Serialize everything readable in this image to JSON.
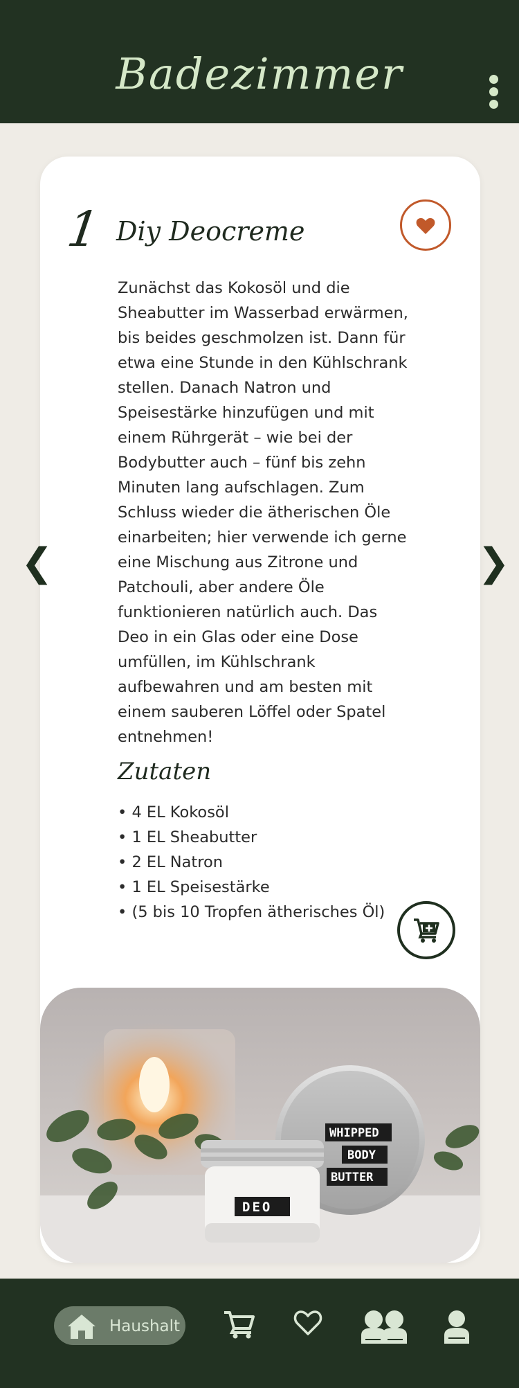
{
  "header": {
    "title": "Badezimmer",
    "menu_icon": "kebab-menu-icon"
  },
  "recipe": {
    "number": "1",
    "title": "Diy Deocreme",
    "favorite_icon": "heart-icon",
    "description": "Zunächst das Kokosöl und die Sheabutter im Wasserbad erwärmen, bis beides geschmolzen ist. Dann für etwa eine Stunde in den Kühlschrank stellen. Danach Natron und Speisestärke hinzufügen und mit einem Rührgerät – wie bei der Bodybutter auch – fünf bis zehn Minuten lang aufschlagen. Zum Schluss wieder die ätherischen Öle einarbeiten; hier verwende ich gerne eine Mischung aus Zitrone und Patchouli, aber andere Öle funktionieren natürlich auch. Das Deo in ein Glas oder eine Dose umfüllen, im Kühlschrank aufbewahren und am besten mit einem sauberen Löffel oder Spatel entnehmen!",
    "ingredients_title": "Zutaten",
    "ingredients": [
      "4 EL Kokosöl",
      "1 EL Sheabutter",
      "2 EL Natron",
      "1 EL Speisestärke",
      "(5 bis 10 Tropfen ätherisches Öl)"
    ],
    "add_to_cart_icon": "cart-plus-icon",
    "photo_labels": {
      "jar": "DEO",
      "lid": [
        "WHIPPED",
        "BODY",
        "BUTTER"
      ]
    }
  },
  "pager": {
    "prev_icon": "chevron-left-icon",
    "next_icon": "chevron-right-icon",
    "prev_glyph": "❮",
    "next_glyph": "❯"
  },
  "bottom_nav": {
    "items": [
      {
        "label": "Haushalt",
        "icon": "home-icon",
        "active": true
      },
      {
        "label": "",
        "icon": "cart-icon",
        "active": false
      },
      {
        "label": "",
        "icon": "heart-outline-icon",
        "active": false
      },
      {
        "label": "",
        "icon": "group-icon",
        "active": false
      },
      {
        "label": "",
        "icon": "profile-icon",
        "active": false
      }
    ]
  },
  "colors": {
    "header_bg": "#223222",
    "accent": "#c1592a",
    "page_bg": "#efece6",
    "title_tint": "#d5e8c8"
  }
}
